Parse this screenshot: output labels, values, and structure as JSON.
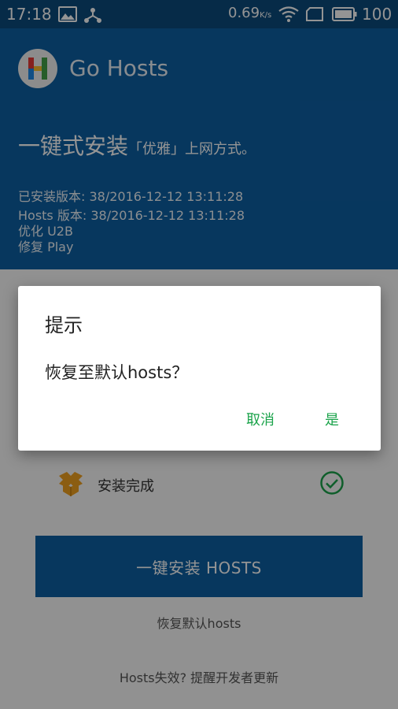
{
  "status_bar": {
    "time": "17:18",
    "speed": "0.69",
    "speed_unit": "K/s",
    "battery": "100"
  },
  "header": {
    "app_title": "Go Hosts",
    "headline_main": "一键式安装",
    "headline_tag": "「优雅」上网方式。",
    "installed_version": "已安装版本: 38/2016-12-12 13:11:28",
    "hosts_version": "Hosts 版本: 38/2016-12-12 13:11:28",
    "optimize": "优化 U2B",
    "repair": "修复 Play"
  },
  "steps": {
    "install_complete": "安装完成"
  },
  "actions": {
    "install_button": "一键安装 HOSTS",
    "restore_default": "恢复默认hosts",
    "feedback": "Hosts失效? 提醒开发者更新"
  },
  "dialog": {
    "title": "提示",
    "message": "恢复至默认hosts？",
    "cancel": "取消",
    "confirm": "是"
  },
  "colors": {
    "primary": "#0d5fa3",
    "accent_green": "#1aa34a",
    "box_orange": "#f0a020"
  }
}
